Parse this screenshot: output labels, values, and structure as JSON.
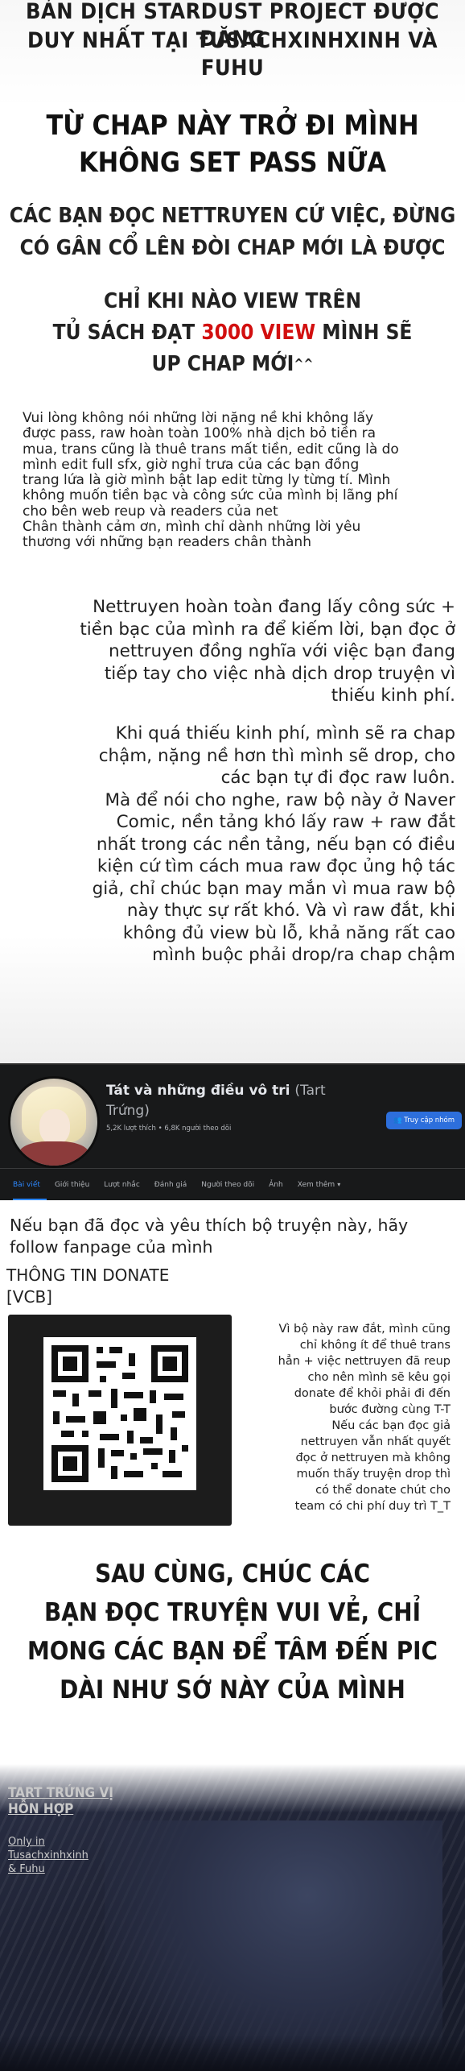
{
  "header": {
    "credit_line1": "BẢN DỊCH STARDUST PROJECT ĐƯỢC ĐĂNG",
    "credit_line2": "DUY NHẤT TẠI TUSACHXINHXINH VÀ FUHU",
    "notice_line1": "TỪ CHAP NÀY TRỞ ĐI MÌNH",
    "notice_line2": "KHÔNG SET PASS NỮA",
    "sub_line1": "CÁC BẠN ĐỌC NETTRUYEN CỨ VIỆC, ĐỪNG",
    "sub_line2": "CÓ GÂN CỔ LÊN ĐÒI CHAP MỚI LÀ ĐƯỢC",
    "view_line1": "CHỈ KHI NÀO VIEW TRÊN",
    "view_line2_pre": "TỦ SÁCH ĐẠT ",
    "view_line2_red": "3000 VIEW",
    "view_line2_post": " MÌNH SẼ",
    "view_line3": "UP CHAP MỚI",
    "view_line3_sup": "^^"
  },
  "paragraph1": "Vui lòng không nói những lời nặng nề khi không lấy\nđược pass, raw hoàn toàn 100% nhà dịch bỏ tiền ra\nmua, trans cũng là thuê trans mất tiền, edit cũng là do\nmình edit full sfx,  giờ nghỉ trưa của các bạn đồng\ntrang lứa là giờ mình bật lap edit từng ly từng tí. Mình\nkhông muốn tiền bạc và công sức của mình bị lãng phí\ncho bên web reup và readers của net\nChân thành cảm ơn, mình chỉ dành những lời yêu\nthương với những bạn readers chân thành",
  "paragraph2": "Nettruyen hoàn toàn đang lấy công sức +\ntiền bạc của mình ra để kiếm lời, bạn đọc ở\nnettruyen đồng nghĩa với việc bạn đang\ntiếp tay cho việc nhà dịch drop truyện vì\nthiếu kinh phí.",
  "paragraph3": "Khi quá thiếu kinh phí, mình sẽ ra chap\nchậm, nặng nề hơn thì mình sẽ drop, cho\ncác bạn tự đi đọc raw luôn.\nMà để nói cho nghe, raw bộ này ở Naver\nComic, nền tảng khó lấy raw + raw đắt\nnhất trong các nền tảng, nếu bạn có điều\nkiện cứ tìm cách mua raw đọc ủng hộ tác\ngiả, chỉ chúc bạn may mắn vì mua raw bộ\nnày thực sự rất khó. Và vì raw đắt, khi\nkhông đủ view bù lỗ, khả năng rất cao\nmình buộc phải drop/ra chap chậm",
  "facebook": {
    "page_name": "Tát và những điều vô tri",
    "page_name_muted": "(Tart Trứng)",
    "stats": "5,2K lượt thích • 6,8K người theo dõi",
    "follow_button": "Truy cập nhóm",
    "tabs": [
      "Bài viết",
      "Giới thiệu",
      "Lượt nhắc",
      "Đánh giá",
      "Người theo dõi",
      "Ảnh",
      "Xem thêm"
    ]
  },
  "donate": {
    "follow_text": "Nếu bạn đã đọc và yêu thích bộ truyện này, hãy follow fanpage của mình",
    "title_line1": "THÔNG TIN DONATE",
    "title_line2": "[VCB]",
    "note": "Vì bộ này raw đắt, mình cũng\nchỉ không ít để thuê trans\nhẳn + việc nettruyen đã reup\ncho nên mình sẽ kêu gọi\ndonate để khỏi phải đi đến\nbước đường cùng T-T\nNếu các bạn đọc giả\nnettruyen vẫn nhất quyết\nđọc ở nettruyen mà không\nmuốn thấy truyện drop thì\ncó thể donate chút cho\nteam có chi phí duy trì T_T"
  },
  "closing": {
    "line1": "SAU CÙNG, CHÚC CÁC",
    "line2": "BẠN ĐỌC TRUYỆN VUI VẺ, CHỈ",
    "line3": "MONG CÁC BẠN ĐỂ TÂM ĐẾN PIC",
    "line4": "DÀI NHƯ SỚ NÀY CỦA MÌNH"
  },
  "signature": {
    "line1": "TART TRỨNG VỊ",
    "line2": "HỖN HỢP",
    "small": "Only in\nTusachxinhxinh\n& Fuhu"
  },
  "colors": {
    "accent_red": "#d20f0f",
    "facebook_blue": "#2d88ff",
    "facebook_dark": "#18191a"
  }
}
